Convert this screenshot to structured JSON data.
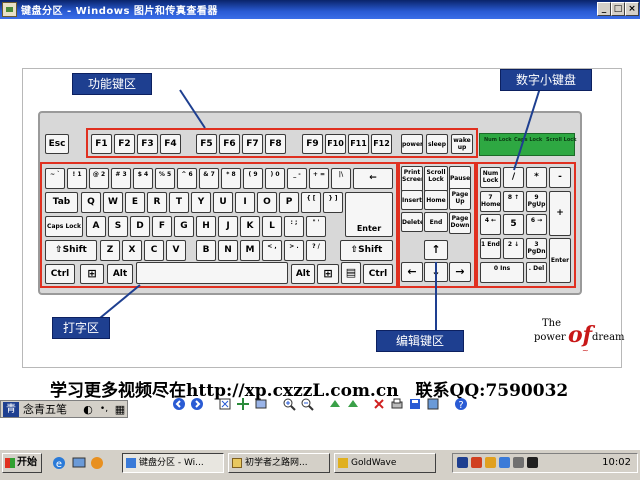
{
  "window": {
    "title": "键盘分区 - Windows 图片和传真查看器",
    "minimize": "_",
    "maximize": "□",
    "close": "×"
  },
  "slide": {
    "callouts": {
      "function_zone": "功能键区",
      "numeric_zone": "数字小键盘",
      "typing_zone": "打字区",
      "editing_zone": "编辑键区"
    },
    "logo": {
      "the": "The",
      "power": "power",
      "of": "of",
      "dream": "dream"
    },
    "promo": "学习更多视频尽在http://xp.cxzzL.com.cn　联系QQ:7590032"
  },
  "keyboard": {
    "esc": "Esc",
    "fkeys": [
      "F1",
      "F2",
      "F3",
      "F4",
      "F5",
      "F6",
      "F7",
      "F8",
      "F9",
      "F10",
      "F11",
      "F12"
    ],
    "power_keys": [
      "power",
      "sleep",
      "wake up"
    ],
    "row_num": [
      "~ `",
      "! 1",
      "@ 2",
      "# 3",
      "$ 4",
      "% 5",
      "^ 6",
      "& 7",
      "* 8",
      "( 9",
      ") 0",
      "_ -",
      "+ =",
      "|\\",
      "←"
    ],
    "row_q": [
      "Tab",
      "Q",
      "W",
      "E",
      "R",
      "T",
      "Y",
      "U",
      "I",
      "O",
      "P",
      "{ [",
      "} ]"
    ],
    "row_a": [
      "Caps Lock",
      "A",
      "S",
      "D",
      "F",
      "G",
      "H",
      "J",
      "K",
      "L",
      ": ;",
      "\" '",
      "Enter"
    ],
    "row_z": [
      "⇧Shift",
      "Z",
      "X",
      "C",
      "V",
      "B",
      "N",
      "M",
      "< ,",
      "> .",
      "? /",
      "⇧Shift"
    ],
    "row_ctrl": [
      "Ctrl",
      "⊞",
      "Alt",
      "",
      "Alt",
      "⊞",
      "▤",
      "Ctrl"
    ],
    "edit_top": [
      "Print Screen",
      "Scroll Lock",
      "Pause"
    ],
    "edit_mid": [
      "Insert",
      "Home",
      "Page Up",
      "Delete",
      "End",
      "Page Down"
    ],
    "arrows": [
      "↑",
      "←",
      "↓",
      "→"
    ],
    "numpad": [
      "Num Lock",
      "/",
      "*",
      "-",
      "7 Home",
      "8 ↑",
      "9 PgUp",
      "+",
      "4 ←",
      "5",
      "6 →",
      "1 End",
      "2 ↓",
      "3 PgDn",
      "Enter",
      "0 Ins",
      ". Del"
    ],
    "leds": [
      "Num Lock",
      "Caps Lock",
      "Scroll Lock"
    ]
  },
  "ime": {
    "logo": "青",
    "name": "念青五笔",
    "moon": "◐",
    "punct": "•,",
    "kbd": "▦"
  },
  "taskbar": {
    "start": "开始",
    "tasks": [
      "键盘分区 - Wi...",
      "初学者之路网...",
      "GoldWave"
    ],
    "clock": "10:02"
  },
  "colors": {
    "titlebar": "#0a246a",
    "callout": "#1e3f90",
    "zone_border": "#e03020",
    "led_panel": "#2ea842"
  }
}
